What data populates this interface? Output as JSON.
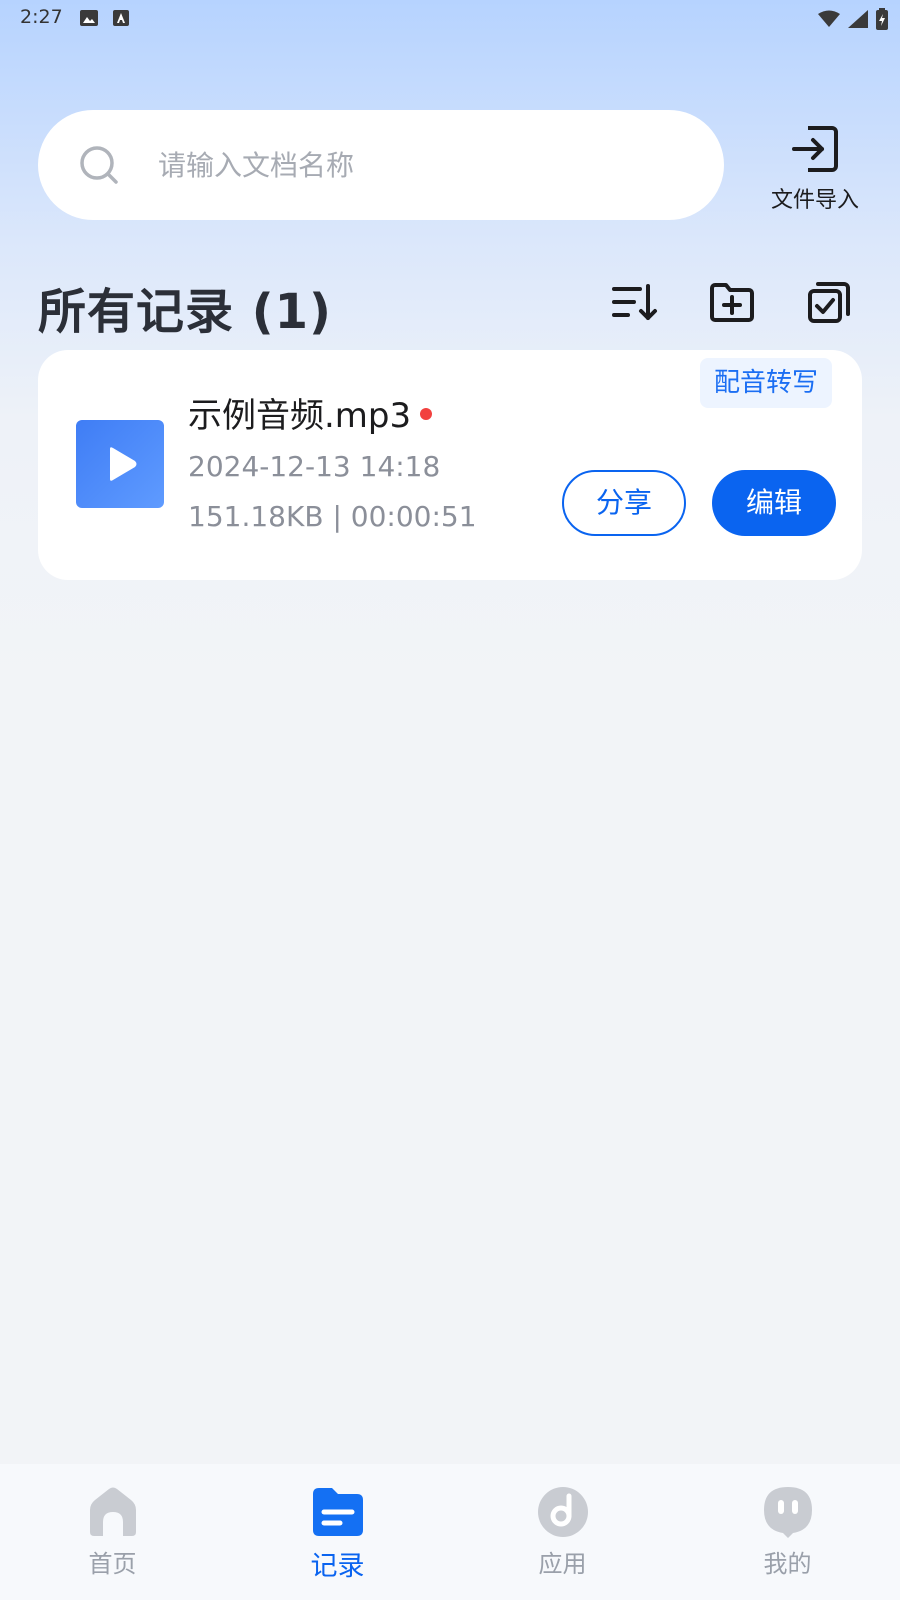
{
  "status_bar": {
    "time": "2:27"
  },
  "search": {
    "placeholder": "请输入文档名称",
    "value": ""
  },
  "import": {
    "label": "文件导入"
  },
  "records": {
    "title": "所有记录 (1)",
    "items": [
      {
        "name": "示例音频.mp3",
        "date": "2024-12-13 14:18",
        "meta": "151.18KB | 00:00:51",
        "tag": "配音转写",
        "share_label": "分享",
        "edit_label": "编辑",
        "unread": true
      }
    ]
  },
  "bottom_nav": {
    "items": [
      {
        "label": "首页",
        "icon": "home-icon",
        "active": false
      },
      {
        "label": "记录",
        "icon": "records-folder-icon",
        "active": true
      },
      {
        "label": "应用",
        "icon": "apps-icon",
        "active": false
      },
      {
        "label": "我的",
        "icon": "profile-icon",
        "active": false
      }
    ]
  },
  "colors": {
    "accent": "#0a64f0",
    "unread_dot": "#f2413f",
    "tag_bg": "#edf4ff"
  }
}
